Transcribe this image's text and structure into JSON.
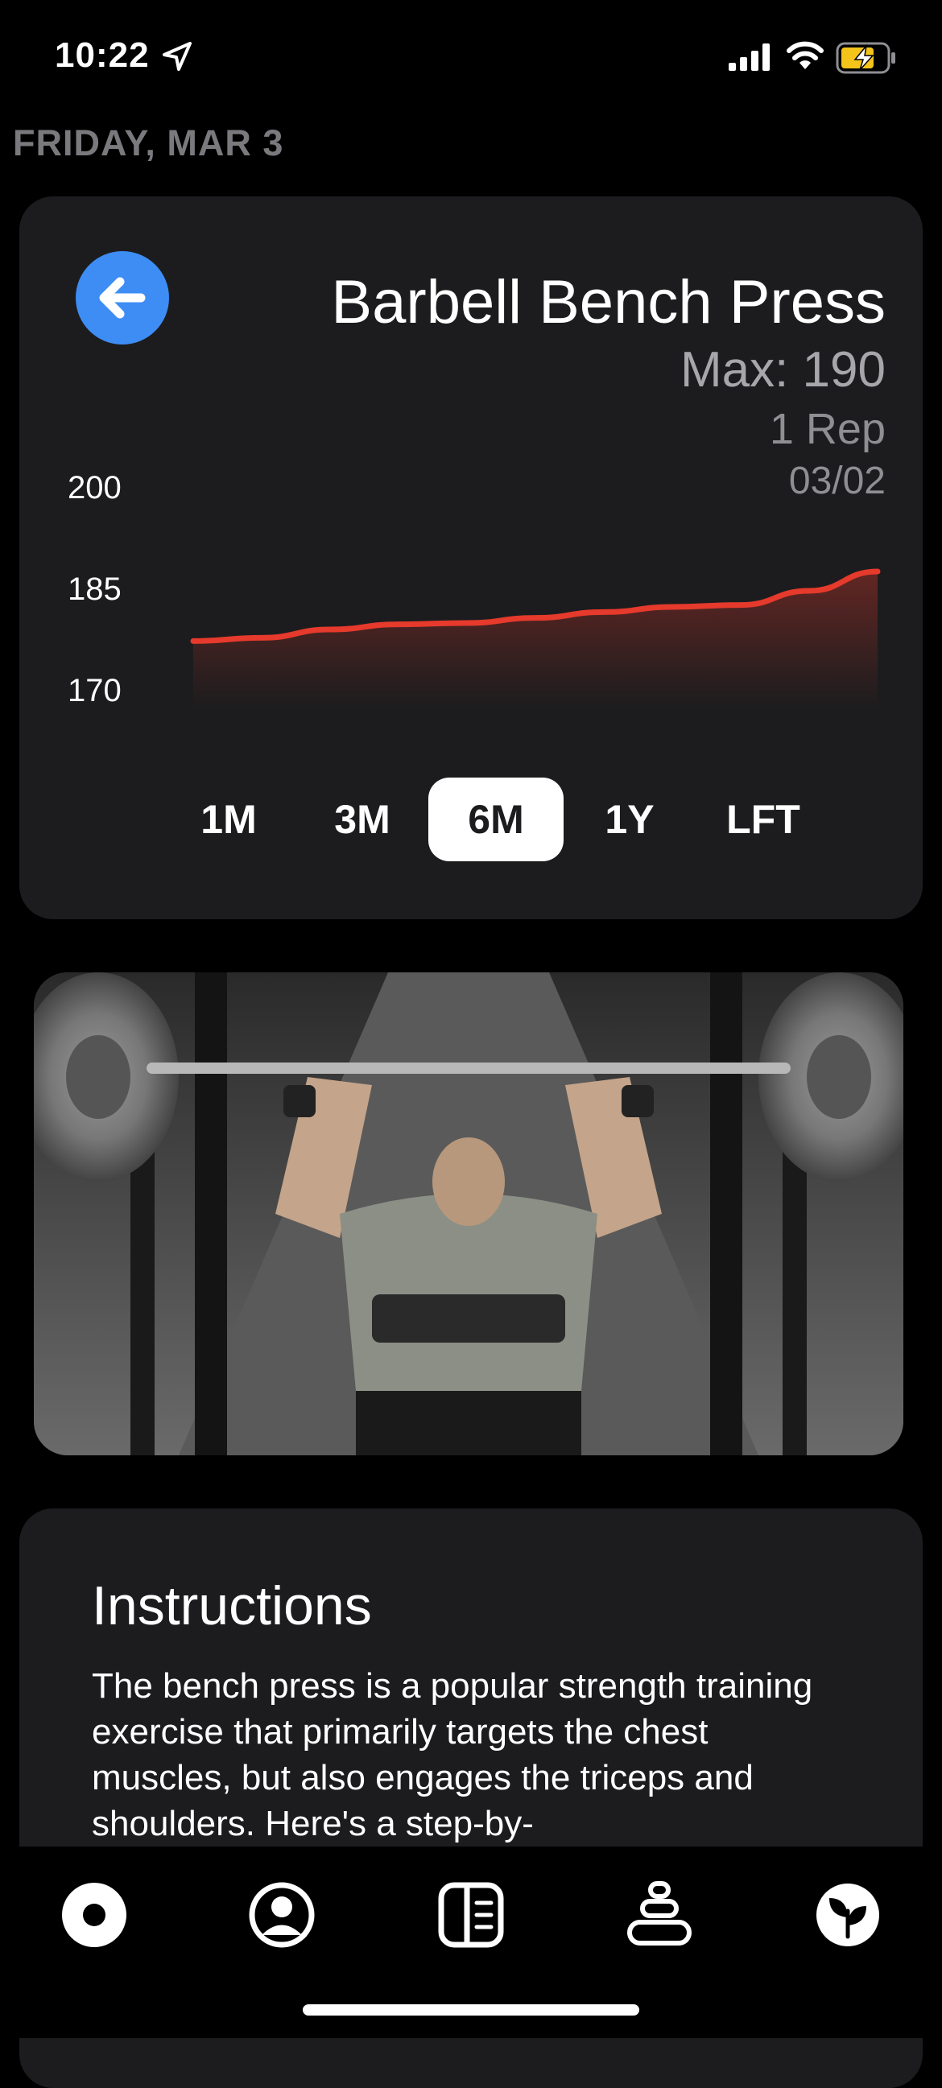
{
  "status_bar": {
    "time": "10:22",
    "icons": [
      "location-arrow-icon",
      "cellular-signal-icon",
      "wifi-icon",
      "battery-charging-icon"
    ]
  },
  "header": {
    "date": "FRIDAY, MAR 3"
  },
  "exercise": {
    "title": "Barbell Bench Press",
    "max": "Max: 190",
    "reps": "1 Rep",
    "date": "03/02"
  },
  "colors": {
    "background": "#000000",
    "card": "#1c1c1e",
    "accent_blue": "#3d8df5",
    "line_red": "#e53a2c",
    "muted_text": "#7a7a7e"
  },
  "chart_data": {
    "type": "area",
    "y_ticks": [
      "200",
      "185",
      "170"
    ],
    "ylim": [
      170,
      200
    ],
    "x": [
      0,
      1,
      2,
      3,
      4,
      5,
      6,
      7,
      8,
      9,
      10
    ],
    "series": [
      {
        "values": [
          179.2,
          179.7,
          181.0,
          181.8,
          182.0,
          182.8,
          183.7,
          184.5,
          184.8,
          187.0,
          190.0
        ]
      }
    ]
  },
  "range_selector": {
    "options": [
      "1M",
      "3M",
      "6M",
      "1Y",
      "LFT"
    ],
    "selected": "6M"
  },
  "instructions": {
    "title": "Instructions",
    "body": "The bench press is a popular strength training exercise that primarily targets the chest muscles, but also engages the triceps and shoulders. Here's a step-by-"
  },
  "tab_bar": {
    "items": [
      "record-icon",
      "profile-icon",
      "journal-icon",
      "stack-icon",
      "nutrition-leaf-icon"
    ]
  }
}
